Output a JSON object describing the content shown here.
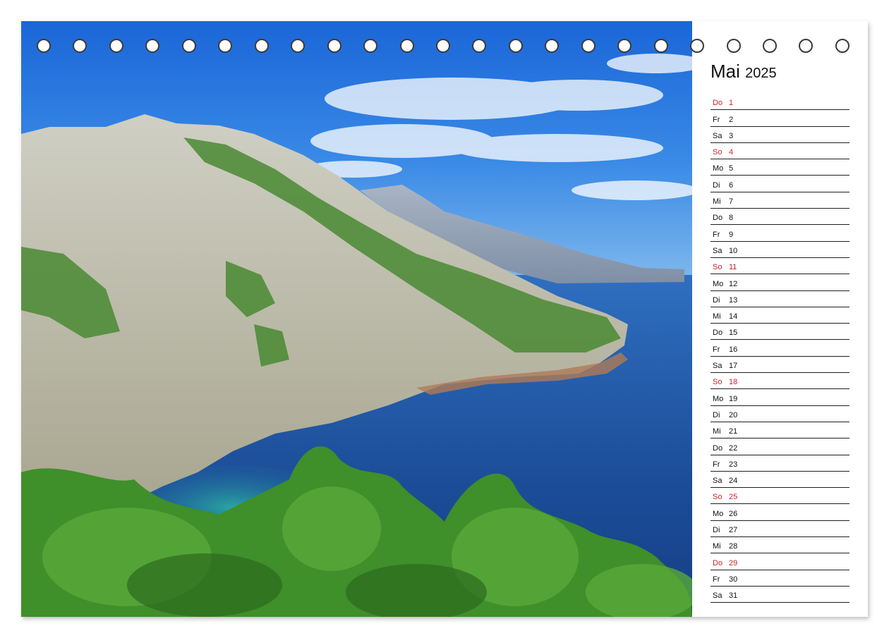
{
  "calendar": {
    "month": "Mai",
    "year": "2025",
    "days": [
      {
        "weekday": "Do",
        "day": "1",
        "holiday": true
      },
      {
        "weekday": "Fr",
        "day": "2"
      },
      {
        "weekday": "Sa",
        "day": "3"
      },
      {
        "weekday": "So",
        "day": "4",
        "holiday": true
      },
      {
        "weekday": "Mo",
        "day": "5"
      },
      {
        "weekday": "Di",
        "day": "6"
      },
      {
        "weekday": "Mi",
        "day": "7"
      },
      {
        "weekday": "Do",
        "day": "8"
      },
      {
        "weekday": "Fr",
        "day": "9"
      },
      {
        "weekday": "Sa",
        "day": "10"
      },
      {
        "weekday": "So",
        "day": "11",
        "holiday": true
      },
      {
        "weekday": "Mo",
        "day": "12"
      },
      {
        "weekday": "Di",
        "day": "13"
      },
      {
        "weekday": "Mi",
        "day": "14"
      },
      {
        "weekday": "Do",
        "day": "15"
      },
      {
        "weekday": "Fr",
        "day": "16"
      },
      {
        "weekday": "Sa",
        "day": "17"
      },
      {
        "weekday": "So",
        "day": "18",
        "holiday": true
      },
      {
        "weekday": "Mo",
        "day": "19"
      },
      {
        "weekday": "Di",
        "day": "20"
      },
      {
        "weekday": "Mi",
        "day": "21"
      },
      {
        "weekday": "Do",
        "day": "22"
      },
      {
        "weekday": "Fr",
        "day": "23"
      },
      {
        "weekday": "Sa",
        "day": "24"
      },
      {
        "weekday": "So",
        "day": "25",
        "holiday": true
      },
      {
        "weekday": "Mo",
        "day": "26"
      },
      {
        "weekday": "Di",
        "day": "27"
      },
      {
        "weekday": "Mi",
        "day": "28"
      },
      {
        "weekday": "Do",
        "day": "29",
        "holiday": true
      },
      {
        "weekday": "Fr",
        "day": "30"
      },
      {
        "weekday": "Sa",
        "day": "31"
      }
    ]
  },
  "colors": {
    "holiday_red": "#d0202a",
    "sky_blue": "#1f78e0",
    "sea_blue": "#1d4f9a",
    "forest_green": "#3f8f2a"
  },
  "binding_ring_count": 23
}
